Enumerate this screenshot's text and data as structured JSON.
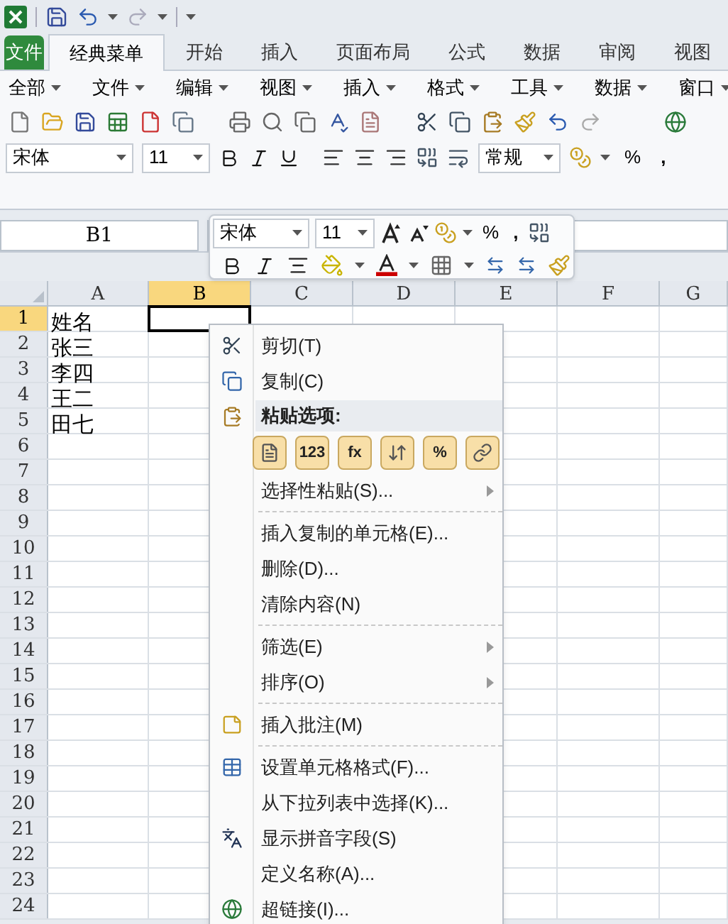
{
  "tabs": [
    {
      "label": "文件",
      "kind": "file",
      "selected": false
    },
    {
      "label": "经典菜单",
      "kind": "tab",
      "selected": true
    },
    {
      "label": "开始",
      "kind": "tab",
      "selected": false
    },
    {
      "label": "插入",
      "kind": "tab",
      "selected": false
    },
    {
      "label": "页面布局",
      "kind": "tab",
      "selected": false
    },
    {
      "label": "公式",
      "kind": "tab",
      "selected": false
    },
    {
      "label": "数据",
      "kind": "tab",
      "selected": false
    },
    {
      "label": "审阅",
      "kind": "tab",
      "selected": false
    },
    {
      "label": "视图",
      "kind": "tab",
      "selected": false
    }
  ],
  "classic_menu": [
    "全部",
    "文件",
    "编辑",
    "视图",
    "插入",
    "格式",
    "工具",
    "数据",
    "窗口"
  ],
  "format_bar": {
    "font": "宋体",
    "size": "11",
    "number_format": "常规",
    "percent": "%",
    "comma": ","
  },
  "name_box": "B1",
  "columns": [
    {
      "label": "A",
      "selected": false
    },
    {
      "label": "B",
      "selected": true
    },
    {
      "label": "C",
      "selected": false
    },
    {
      "label": "D",
      "selected": false
    },
    {
      "label": "E",
      "selected": false
    },
    {
      "label": "F",
      "selected": false
    },
    {
      "label": "G",
      "selected": false
    }
  ],
  "rows": [
    {
      "label": "1",
      "selected": true,
      "cell_a": "姓名"
    },
    {
      "label": "2",
      "selected": false,
      "cell_a": "张三"
    },
    {
      "label": "3",
      "selected": false,
      "cell_a": "李四"
    },
    {
      "label": "4",
      "selected": false,
      "cell_a": "王二"
    },
    {
      "label": "5",
      "selected": false,
      "cell_a": "田七"
    },
    {
      "label": "6",
      "selected": false
    },
    {
      "label": "7",
      "selected": false
    },
    {
      "label": "8",
      "selected": false
    },
    {
      "label": "9",
      "selected": false
    },
    {
      "label": "10",
      "selected": false
    },
    {
      "label": "11",
      "selected": false
    },
    {
      "label": "12",
      "selected": false
    },
    {
      "label": "13",
      "selected": false
    },
    {
      "label": "14",
      "selected": false
    },
    {
      "label": "15",
      "selected": false
    },
    {
      "label": "16",
      "selected": false
    },
    {
      "label": "17",
      "selected": false
    },
    {
      "label": "18",
      "selected": false
    },
    {
      "label": "19",
      "selected": false
    },
    {
      "label": "20",
      "selected": false
    },
    {
      "label": "21",
      "selected": false
    },
    {
      "label": "22",
      "selected": false
    },
    {
      "label": "23",
      "selected": false
    },
    {
      "label": "24",
      "selected": false
    }
  ],
  "mini_toolbar": {
    "font": "宋体",
    "size": "11",
    "percent": "%",
    "comma": ","
  },
  "context_menu": [
    {
      "kind": "item",
      "label": "剪切(T)",
      "submenu": false
    },
    {
      "kind": "item",
      "label": "复制(C)",
      "submenu": false
    },
    {
      "kind": "header",
      "label": "粘贴选项:"
    },
    {
      "kind": "paste",
      "options": [
        {
          "kind": "icon"
        },
        {
          "kind": "text",
          "label": "123"
        },
        {
          "kind": "text",
          "label": "fx"
        },
        {
          "kind": "icon"
        },
        {
          "kind": "text",
          "label": "%"
        },
        {
          "kind": "icon"
        }
      ]
    },
    {
      "kind": "item",
      "label": "选择性粘贴(S)...",
      "submenu": true
    },
    {
      "kind": "separator"
    },
    {
      "kind": "item",
      "label": "插入复制的单元格(E)...",
      "submenu": false
    },
    {
      "kind": "item",
      "label": "删除(D)...",
      "submenu": false
    },
    {
      "kind": "item",
      "label": "清除内容(N)",
      "submenu": false
    },
    {
      "kind": "separator"
    },
    {
      "kind": "item",
      "label": "筛选(E)",
      "submenu": true
    },
    {
      "kind": "item",
      "label": "排序(O)",
      "submenu": true
    },
    {
      "kind": "separator"
    },
    {
      "kind": "item",
      "label": "插入批注(M)",
      "submenu": false
    },
    {
      "kind": "separator"
    },
    {
      "kind": "item",
      "label": "设置单元格格式(F)...",
      "submenu": false
    },
    {
      "kind": "item",
      "label": "从下拉列表中选择(K)...",
      "submenu": false
    },
    {
      "kind": "item",
      "label": "显示拼音字段(S)",
      "submenu": false
    },
    {
      "kind": "item",
      "label": "定义名称(A)...",
      "submenu": false
    },
    {
      "kind": "item",
      "label": "超链接(I)...",
      "submenu": false
    }
  ]
}
